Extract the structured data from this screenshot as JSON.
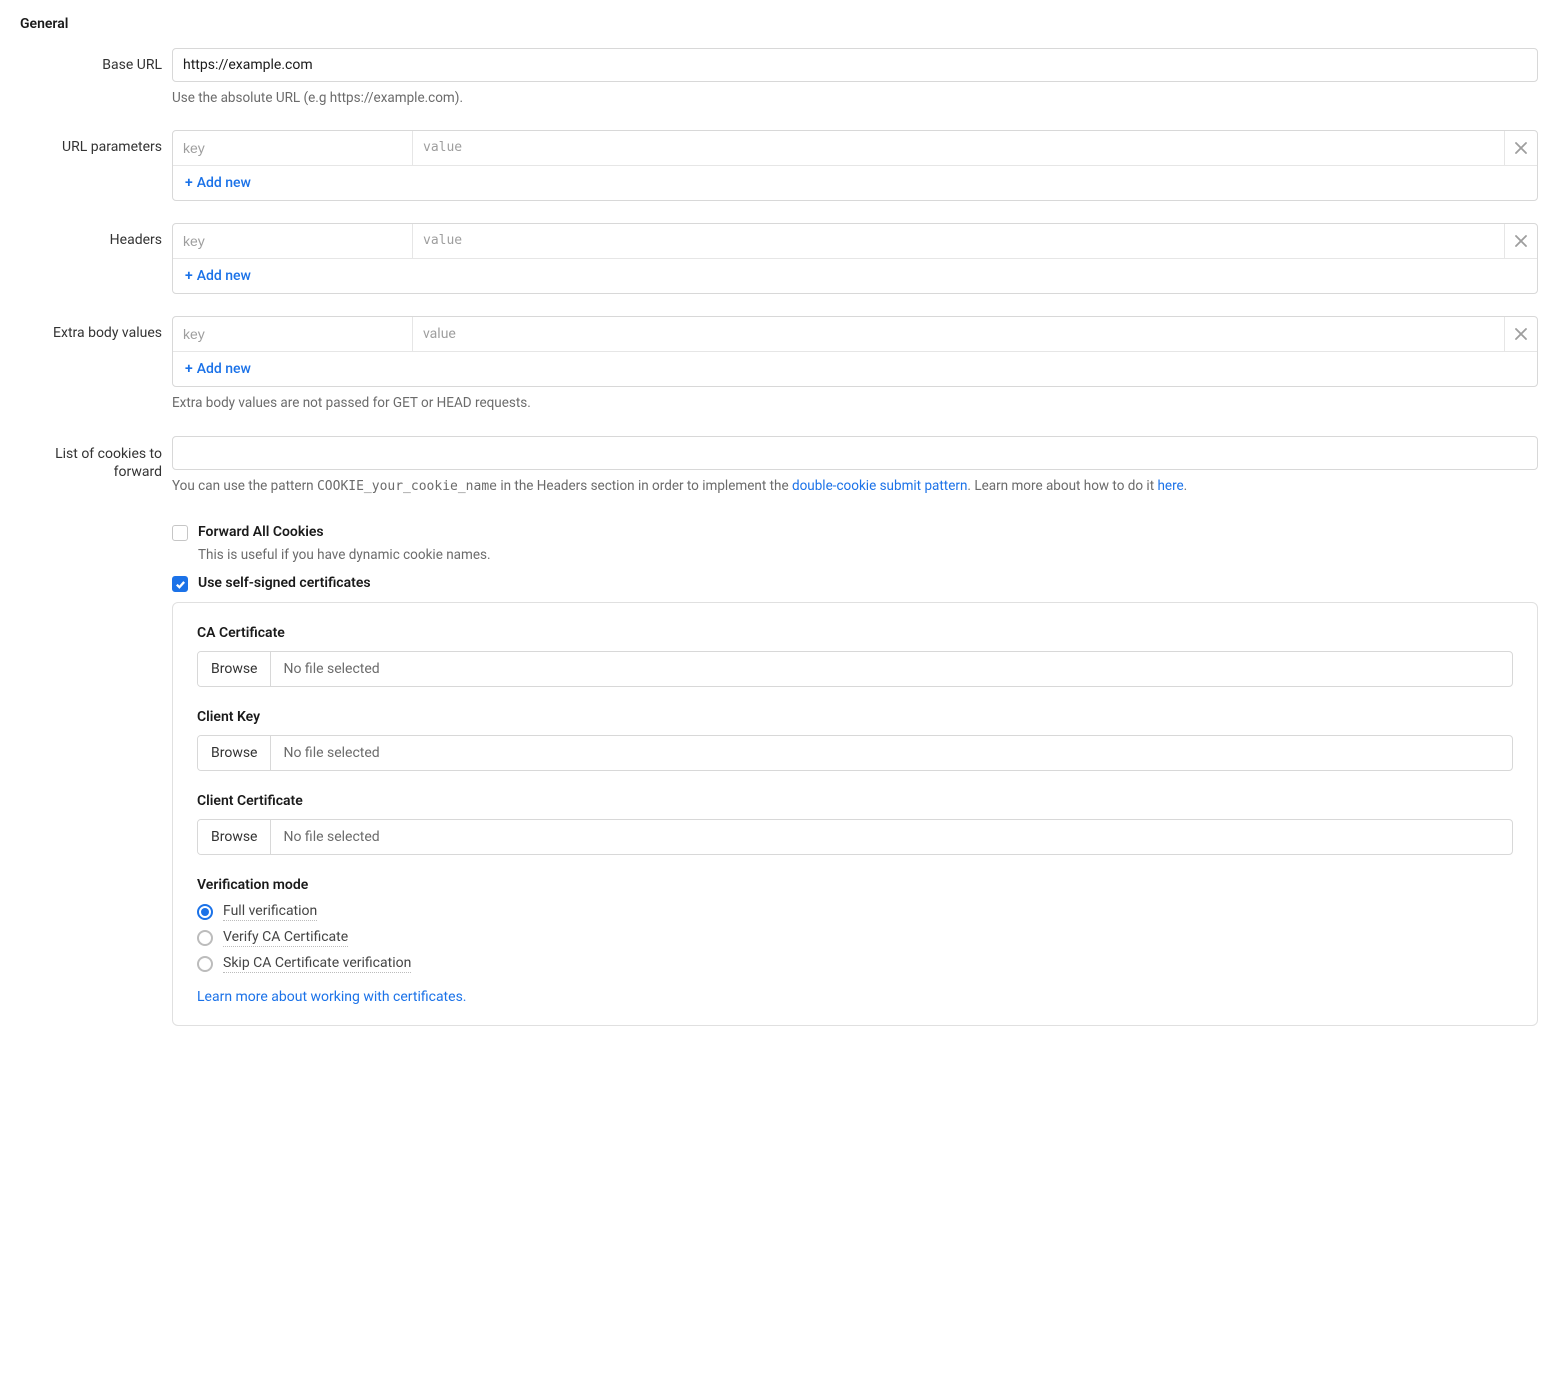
{
  "section_title": "General",
  "base_url": {
    "label": "Base URL",
    "value": "https://example.com",
    "help": "Use the absolute URL (e.g https://example.com)."
  },
  "url_params": {
    "label": "URL parameters",
    "key_placeholder": "key",
    "value_placeholder": "value",
    "add_label": "Add new"
  },
  "headers": {
    "label": "Headers",
    "key_placeholder": "key",
    "value_placeholder": "value",
    "add_label": "Add new"
  },
  "extra_body": {
    "label": "Extra body values",
    "key_placeholder": "key",
    "value_placeholder": "value",
    "add_label": "Add new",
    "help": "Extra body values are not passed for GET or HEAD requests."
  },
  "cookies": {
    "label": "List of cookies to forward",
    "value": "",
    "help_pre": "You can use the pattern ",
    "help_code": "COOKIE_your_cookie_name",
    "help_mid": " in the Headers section in order to implement the ",
    "help_link1": "double-cookie submit pattern",
    "help_post1": ". Learn more about how to do it ",
    "help_link2": "here",
    "help_post2": "."
  },
  "forward_all": {
    "label": "Forward All Cookies",
    "sub": "This is useful if you have dynamic cookie names.",
    "checked": false
  },
  "self_signed": {
    "label": "Use self-signed certificates",
    "checked": true
  },
  "cert": {
    "ca_label": "CA Certificate",
    "key_label": "Client Key",
    "client_label": "Client Certificate",
    "browse": "Browse",
    "no_file": "No file selected",
    "verification_label": "Verification mode",
    "options": {
      "full": "Full verification",
      "verify_ca": "Verify CA Certificate",
      "skip": "Skip CA Certificate verification"
    },
    "selected": "full",
    "learn_more": "Learn more about working with certificates."
  }
}
